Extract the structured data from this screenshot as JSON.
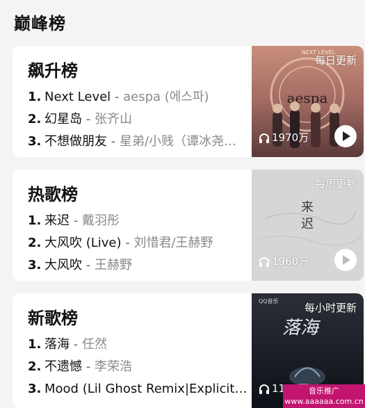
{
  "section_title": "巅峰榜",
  "charts": [
    {
      "title": "飙升榜",
      "update_badge": "每日更新",
      "play_count": "1970万",
      "tracks": [
        {
          "rank": "1.",
          "song": "Next Level",
          "artist": "aespa (에스파)"
        },
        {
          "rank": "2.",
          "song": "幻星岛",
          "artist": "张齐山"
        },
        {
          "rank": "3.",
          "song": "不想做朋友",
          "artist": "星弟/小贱（谭冰尧…"
        }
      ],
      "cover_text": [
        "NEXT LEVEL",
        "aespa"
      ]
    },
    {
      "title": "热歌榜",
      "update_badge": "每周更新",
      "play_count": "1960万",
      "tracks": [
        {
          "rank": "1.",
          "song": "来迟",
          "artist": "戴羽彤"
        },
        {
          "rank": "2.",
          "song": "大风吹 (Live)",
          "artist": "刘惜君/王赫野"
        },
        {
          "rank": "3.",
          "song": "大风吹",
          "artist": "王赫野"
        }
      ],
      "cover_text": [
        "来",
        "迟"
      ]
    },
    {
      "title": "新歌榜",
      "update_badge": "每小时更新",
      "play_count": "1151万",
      "tracks": [
        {
          "rank": "1.",
          "song": "落海",
          "artist": "任然"
        },
        {
          "rank": "2.",
          "song": "不遗憾",
          "artist": "李荣浩"
        },
        {
          "rank": "3.",
          "song": "Mood (Lil Ghost Remix|Explicit)",
          "artist": ""
        }
      ],
      "cover_text": [
        "QQ音乐",
        "落海"
      ]
    }
  ],
  "watermark": {
    "line1": "音乐推广",
    "line2": "www.aaaaaa.com.cn"
  },
  "colors": {
    "card_bg": "#ffffff",
    "page_bg": "#f4f4f4",
    "artist_gray": "#8a8a8a",
    "watermark_bg": "#c2156f"
  }
}
